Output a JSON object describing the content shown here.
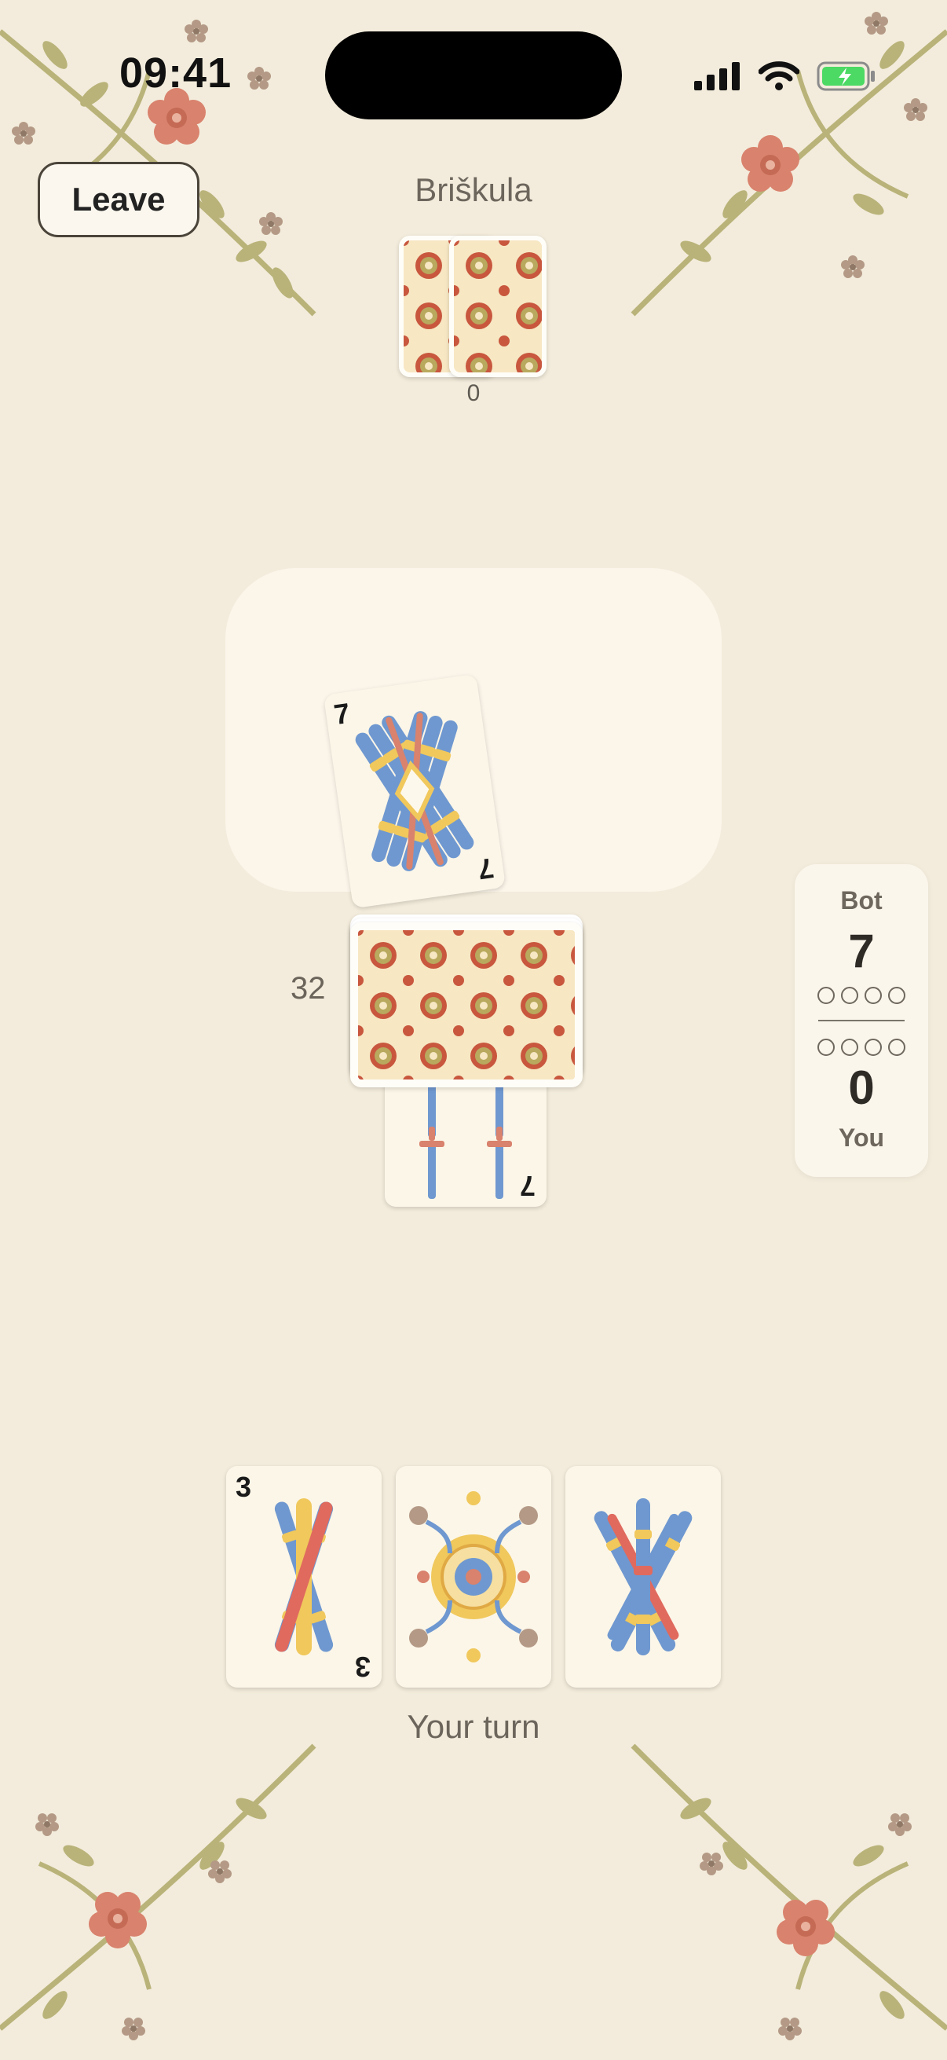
{
  "status_bar": {
    "time": "09:41"
  },
  "header": {
    "leave_label": "Leave",
    "title": "Briškula"
  },
  "opponent": {
    "hand_count": "0"
  },
  "table": {
    "played_card_rank": "7"
  },
  "deck": {
    "remaining": "32",
    "trump_rank": "7"
  },
  "score": {
    "bot_label": "Bot",
    "bot_points": "7",
    "player_label": "You",
    "player_points": "0",
    "bot_games_won": 0,
    "player_games_won": 0,
    "games_to_win": 4
  },
  "hand": {
    "cards": [
      {
        "rank": "3",
        "suit": "clubs-icon"
      },
      {
        "rank": "",
        "suit": "coins-icon"
      },
      {
        "rank": "",
        "suit": "clubs-icon"
      }
    ]
  },
  "turn_status": "Your turn",
  "colors": {
    "background": "#f3ecdc",
    "accent_red": "#d9826d",
    "accent_green": "#b9b37a",
    "club_blue": "#6f98d0",
    "gold": "#f0c85c"
  }
}
